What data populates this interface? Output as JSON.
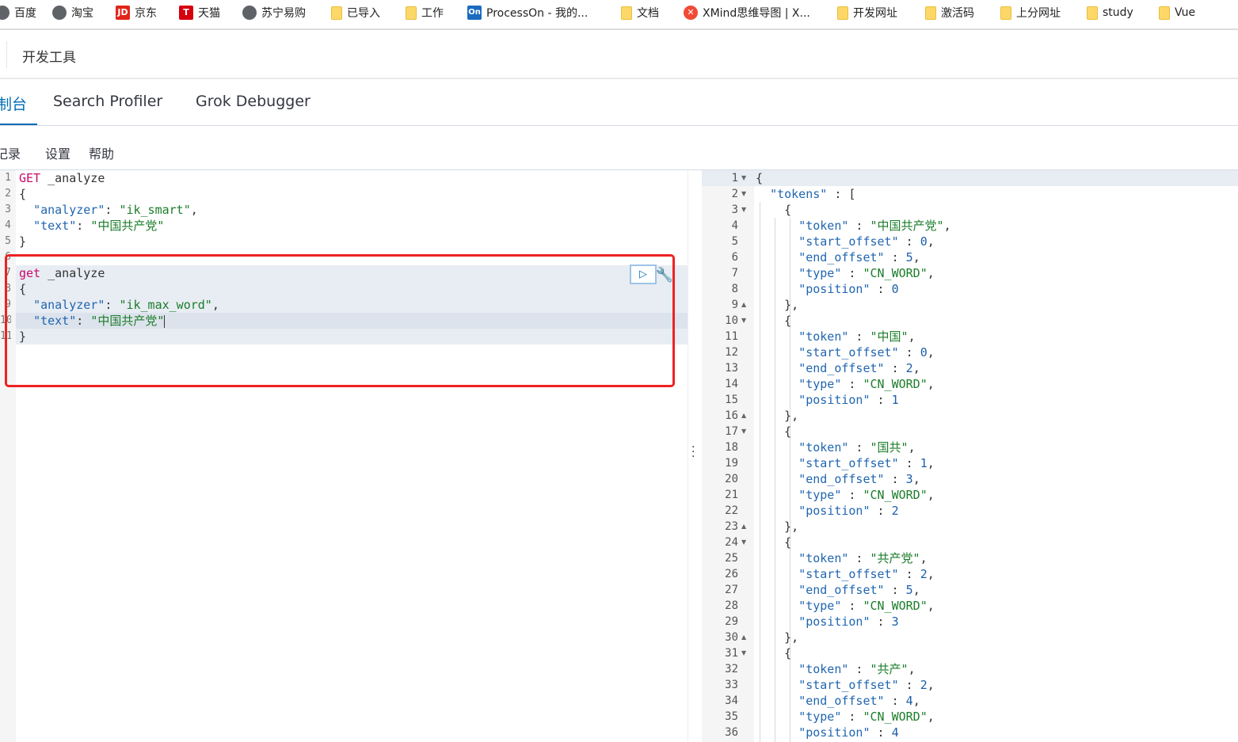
{
  "bookmarks": [
    {
      "label": "百度",
      "icon": "globe-icon"
    },
    {
      "label": "淘宝",
      "icon": "globe-icon"
    },
    {
      "label": "京东",
      "icon": "jd-icon",
      "badge": "JD"
    },
    {
      "label": "天猫",
      "icon": "tmall-icon",
      "badge": "T"
    },
    {
      "label": "苏宁易购",
      "icon": "globe-icon"
    },
    {
      "label": "已导入",
      "icon": "folder-icon"
    },
    {
      "label": "工作",
      "icon": "folder-icon"
    },
    {
      "label": "ProcessOn - 我的...",
      "icon": "processon-icon",
      "badge": "On"
    },
    {
      "label": "文档",
      "icon": "folder-icon"
    },
    {
      "label": "XMind思维导图 | X...",
      "icon": "xmind-icon",
      "badge": "✕"
    },
    {
      "label": "开发网址",
      "icon": "folder-icon"
    },
    {
      "label": "激活码",
      "icon": "folder-icon"
    },
    {
      "label": "上分网址",
      "icon": "folder-icon"
    },
    {
      "label": "study",
      "icon": "folder-icon"
    },
    {
      "label": "Vue",
      "icon": "folder-icon"
    }
  ],
  "header": {
    "title": "开发工具"
  },
  "tabs": [
    {
      "label": "控制台",
      "shown": "制台",
      "active": true
    },
    {
      "label": "Search Profiler"
    },
    {
      "label": "Grok Debugger"
    }
  ],
  "toolbar": {
    "history": "历史记录",
    "history_shown": "记录",
    "settings": "设置",
    "help": "帮助"
  },
  "editor": {
    "gutter_numbers": [
      "1",
      "2",
      "3",
      "4",
      "5",
      "6",
      "7",
      "8",
      "9",
      "10",
      "11"
    ],
    "request1": {
      "method": "GET",
      "endpoint": "_analyze",
      "open_brace": "{",
      "analyzer_key": "\"analyzer\"",
      "analyzer_value": "\"ik_smart\"",
      "text_key": "\"text\"",
      "text_value": "\"中国共产党\"",
      "close_brace": "}"
    },
    "request2": {
      "method": "get",
      "endpoint": "_analyze",
      "open_brace": "{",
      "analyzer_key": "\"analyzer\"",
      "analyzer_value": "\"ik_max_word\"",
      "text_key": "\"text\"",
      "text_value": "\"中国共产党\"",
      "close_brace": "}"
    }
  },
  "output": {
    "line_numbers": [
      "1",
      "2",
      "3",
      "4",
      "5",
      "6",
      "7",
      "8",
      "9",
      "10",
      "11",
      "12",
      "13",
      "14",
      "15",
      "16",
      "17",
      "18",
      "19",
      "20",
      "21",
      "22",
      "23",
      "24",
      "25",
      "26",
      "27",
      "28",
      "29",
      "30",
      "31",
      "32",
      "33",
      "34",
      "35",
      "36"
    ],
    "lines": [
      "{",
      "  \"tokens\" : [",
      "    {",
      "      \"token\" : \"中国共产党\",",
      "      \"start_offset\" : 0,",
      "      \"end_offset\" : 5,",
      "      \"type\" : \"CN_WORD\",",
      "      \"position\" : 0",
      "    },",
      "    {",
      "      \"token\" : \"中国\",",
      "      \"start_offset\" : 0,",
      "      \"end_offset\" : 2,",
      "      \"type\" : \"CN_WORD\",",
      "      \"position\" : 1",
      "    },",
      "    {",
      "      \"token\" : \"国共\",",
      "      \"start_offset\" : 1,",
      "      \"end_offset\" : 3,",
      "      \"type\" : \"CN_WORD\",",
      "      \"position\" : 2",
      "    },",
      "    {",
      "      \"token\" : \"共产党\",",
      "      \"start_offset\" : 2,",
      "      \"end_offset\" : 5,",
      "      \"type\" : \"CN_WORD\",",
      "      \"position\" : 3",
      "    },",
      "    {",
      "      \"token\" : \"共产\",",
      "      \"start_offset\" : 2,",
      "      \"end_offset\" : 4,",
      "      \"type\" : \"CN_WORD\",",
      "      \"position\" : 4"
    ]
  },
  "colors": {
    "accent": "#006bb4",
    "highlight_border": "#ee2222",
    "keyword": "#c80a68",
    "string": "#1b7d2a",
    "key": "#2166b0"
  }
}
